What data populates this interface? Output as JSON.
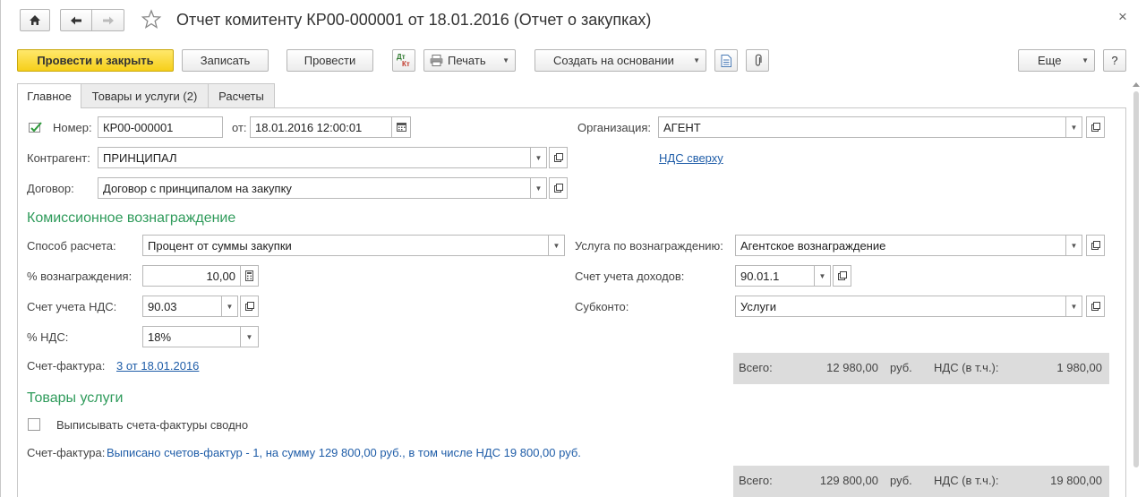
{
  "window": {
    "title": "Отчет комитенту КР00-000001 от 18.01.2016 (Отчет о закупках)",
    "close_glyph": "×"
  },
  "toolbar": {
    "post_close": "Провести и закрыть",
    "save": "Записать",
    "post": "Провести",
    "dt_kt_top": "Дт",
    "dt_kt_bottom": "Кт",
    "print": "Печать",
    "create_based": "Создать на основании",
    "more": "Еще",
    "help": "?"
  },
  "tabs": [
    "Главное",
    "Товары и услуги (2)",
    "Расчеты"
  ],
  "header": {
    "number_label": "Номер:",
    "number_value": "КР00-000001",
    "date_label": "от:",
    "date_value": "18.01.2016 12:00:01",
    "org_label": "Организация:",
    "org_value": "АГЕНТ",
    "contractor_label": "Контрагент:",
    "contractor_value": "ПРИНЦИПАЛ",
    "vat_link": "НДС сверху",
    "contract_label": "Договор:",
    "contract_value": "Договор с принципалом на закупку"
  },
  "commission": {
    "heading": "Комиссионное вознаграждение",
    "calc_method_label": "Способ расчета:",
    "calc_method_value": "Процент от суммы закупки",
    "service_label": "Услуга по вознаграждению:",
    "service_value": "Агентское вознаграждение",
    "percent_label": "% вознаграждения:",
    "percent_value": "10,00",
    "income_account_label": "Счет учета доходов:",
    "income_account_value": "90.01.1",
    "vat_account_label": "Счет учета НДС:",
    "vat_account_value": "90.03",
    "subconto_label": "Субконто:",
    "subconto_value": "Услуги",
    "vat_rate_label": "% НДС:",
    "vat_rate_value": "18%",
    "invoice_label": "Счет-фактура:",
    "invoice_link": "3 от 18.01.2016",
    "total_label": "Всего:",
    "total_value": "12 980,00",
    "currency": "руб.",
    "vat_incl_label": "НДС (в т.ч.):",
    "vat_incl_value": "1 980,00"
  },
  "goods": {
    "heading": "Товары услуги",
    "checkbox_label": "Выписывать счета-фактуры сводно",
    "checkbox_checked": false,
    "invoice_label": "Счет-фактура:",
    "invoice_text": "Выписано счетов-фактур - 1, на сумму 129 800,00 руб., в том числе НДС 19 800,00 руб.",
    "total_label": "Всего:",
    "total_value": "129 800,00",
    "currency": "руб.",
    "vat_incl_label": "НДС (в т.ч.):",
    "vat_incl_value": "19 800,00"
  },
  "colors": {
    "accent_green": "#2f9b5b",
    "link_blue": "#1f5da8",
    "primary_yellow": "#f6cf1a"
  }
}
